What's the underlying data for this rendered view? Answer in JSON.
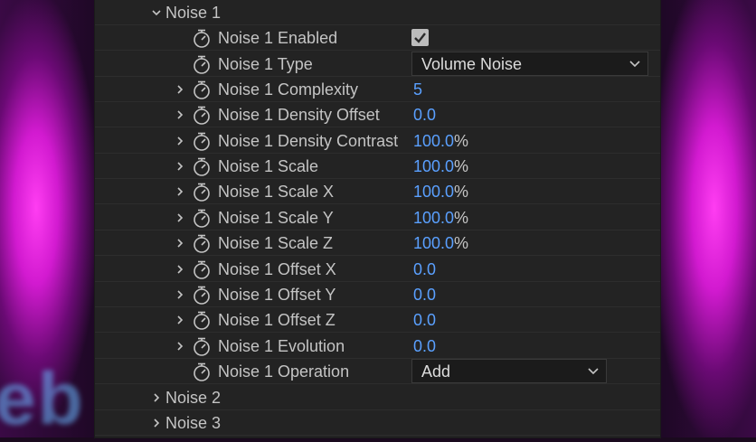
{
  "background": {
    "partial_text": "eb"
  },
  "effect_panel": {
    "group_expanded": {
      "label": "Noise 1"
    },
    "properties": [
      {
        "label": "Noise 1 Enabled",
        "control": "checkbox",
        "checked": true
      },
      {
        "label": "Noise 1 Type",
        "control": "dropdown",
        "value": "Volume Noise"
      },
      {
        "label": "Noise 1 Complexity",
        "control": "number",
        "value": "5",
        "unit": ""
      },
      {
        "label": "Noise 1 Density Offset",
        "control": "number",
        "value": "0.0",
        "unit": ""
      },
      {
        "label": "Noise 1 Density Contrast",
        "control": "number",
        "value": "100.0",
        "unit": "%"
      },
      {
        "label": "Noise 1 Scale",
        "control": "number",
        "value": "100.0",
        "unit": "%"
      },
      {
        "label": "Noise 1 Scale X",
        "control": "number",
        "value": "100.0",
        "unit": "%"
      },
      {
        "label": "Noise 1 Scale Y",
        "control": "number",
        "value": "100.0",
        "unit": "%"
      },
      {
        "label": "Noise 1 Scale Z",
        "control": "number",
        "value": "100.0",
        "unit": "%"
      },
      {
        "label": "Noise 1 Offset X",
        "control": "number",
        "value": "0.0",
        "unit": ""
      },
      {
        "label": "Noise 1 Offset Y",
        "control": "number",
        "value": "0.0",
        "unit": ""
      },
      {
        "label": "Noise 1 Offset Z",
        "control": "number",
        "value": "0.0",
        "unit": ""
      },
      {
        "label": "Noise 1 Evolution",
        "control": "number",
        "value": "0.0",
        "unit": ""
      },
      {
        "label": "Noise 1 Operation",
        "control": "dropdown",
        "value": "Add"
      }
    ],
    "collapsed_groups": [
      {
        "label": "Noise 2"
      },
      {
        "label": "Noise 3"
      }
    ]
  },
  "colors": {
    "panel_bg": "#232323",
    "value_blue": "#5aa0ff",
    "label_gray": "#c4c4c4",
    "background_magenta": "#d21ad0"
  },
  "icons": {
    "expanded": "chevron-down-icon",
    "collapsed": "chevron-right-icon",
    "keyframe": "stopwatch-icon",
    "checkbox": "checkmark-icon",
    "dropdown": "chevron-down-icon"
  }
}
